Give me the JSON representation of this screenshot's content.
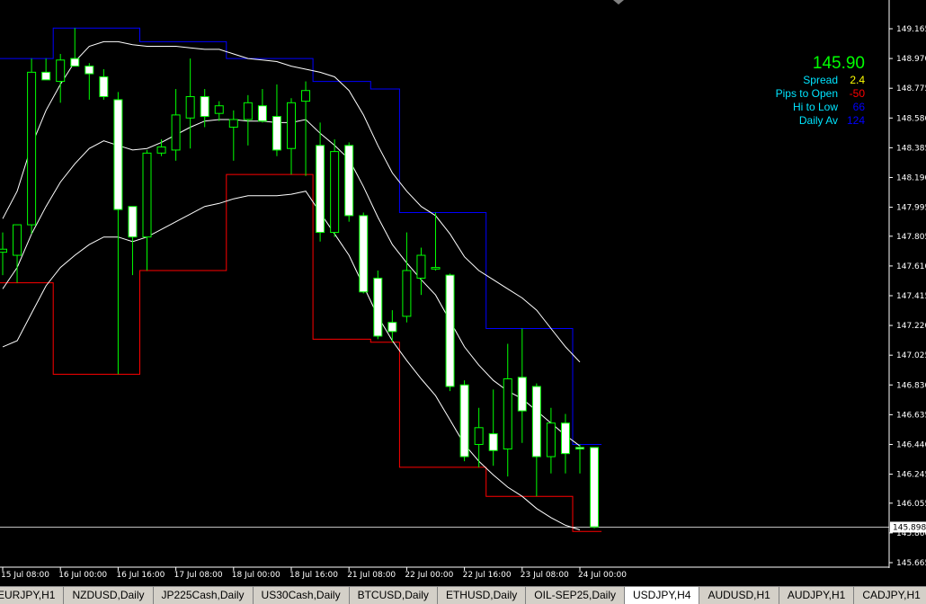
{
  "window": {
    "symbol": "USDJPY",
    "timeframe": "H4"
  },
  "info_panel": {
    "price": "145.90",
    "rows": [
      {
        "label": "Spread",
        "value": "2.4",
        "color": "#ffff00"
      },
      {
        "label": "Pips to Open",
        "value": "-50",
        "color": "#ff0000"
      },
      {
        "label": "Hi to Low",
        "value": "66",
        "color": "#0000ff"
      },
      {
        "label": "Daily Av",
        "value": "124",
        "color": "#0000ff"
      }
    ]
  },
  "colors": {
    "background": "#000000",
    "candle_outline": "#00ff00",
    "candle_bull_fill": "#000000",
    "candle_bear_fill": "#ffffff",
    "upper_channel": "#0000ff",
    "lower_channel": "#ff0000",
    "bollinger": "#ffffff",
    "axis": "#ffffff",
    "current_price_line": "#c0c0c0"
  },
  "chart_data": {
    "type": "candlestick",
    "y_axis_labels": [
      "149.165",
      "148.970",
      "148.775",
      "148.580",
      "148.385",
      "148.190",
      "147.995",
      "147.805",
      "147.610",
      "147.415",
      "147.220",
      "147.025",
      "146.830",
      "146.635",
      "146.440",
      "146.245",
      "146.055",
      "145.860",
      "145.665"
    ],
    "ylim": [
      145.665,
      149.165
    ],
    "current_price_label": "145.898",
    "current_price": 145.898,
    "x_axis_labels": [
      "15 Jul 08:00",
      "16 Jul 00:00",
      "16 Jul 16:00",
      "17 Jul 08:00",
      "18 Jul 00:00",
      "18 Jul 16:00",
      "21 Jul 08:00",
      "22 Jul 00:00",
      "22 Jul 16:00",
      "23 Jul 08:00",
      "24 Jul 00:00"
    ],
    "x_label_bars": [
      0,
      4,
      8,
      12,
      16,
      20,
      24,
      28,
      32,
      36,
      40
    ],
    "candles": [
      {
        "o": 147.7,
        "h": 147.83,
        "l": 147.55,
        "c": 147.72
      },
      {
        "o": 147.68,
        "h": 147.84,
        "l": 147.5,
        "c": 147.88
      },
      {
        "o": 147.88,
        "h": 148.97,
        "l": 147.82,
        "c": 148.88
      },
      {
        "o": 148.88,
        "h": 148.97,
        "l": 148.83,
        "c": 148.83
      },
      {
        "o": 148.82,
        "h": 149.0,
        "l": 148.68,
        "c": 148.96
      },
      {
        "o": 148.97,
        "h": 149.17,
        "l": 148.92,
        "c": 148.92
      },
      {
        "o": 148.92,
        "h": 148.94,
        "l": 148.7,
        "c": 148.87
      },
      {
        "o": 148.85,
        "h": 148.9,
        "l": 148.7,
        "c": 148.72
      },
      {
        "o": 148.7,
        "h": 148.75,
        "l": 146.9,
        "c": 147.98
      },
      {
        "o": 148.0,
        "h": 148.0,
        "l": 147.55,
        "c": 147.8
      },
      {
        "o": 147.8,
        "h": 148.37,
        "l": 147.58,
        "c": 148.35
      },
      {
        "o": 148.35,
        "h": 148.44,
        "l": 148.33,
        "c": 148.39
      },
      {
        "o": 148.37,
        "h": 148.77,
        "l": 148.3,
        "c": 148.6
      },
      {
        "o": 148.58,
        "h": 148.97,
        "l": 148.38,
        "c": 148.72
      },
      {
        "o": 148.72,
        "h": 148.77,
        "l": 148.52,
        "c": 148.59
      },
      {
        "o": 148.61,
        "h": 148.69,
        "l": 148.56,
        "c": 148.66
      },
      {
        "o": 148.52,
        "h": 148.63,
        "l": 148.3,
        "c": 148.57
      },
      {
        "o": 148.57,
        "h": 148.73,
        "l": 148.4,
        "c": 148.68
      },
      {
        "o": 148.66,
        "h": 148.77,
        "l": 148.55,
        "c": 148.56
      },
      {
        "o": 148.59,
        "h": 148.8,
        "l": 148.33,
        "c": 148.37
      },
      {
        "o": 148.38,
        "h": 148.71,
        "l": 148.21,
        "c": 148.68
      },
      {
        "o": 148.69,
        "h": 148.82,
        "l": 148.2,
        "c": 148.76
      },
      {
        "o": 148.4,
        "h": 148.55,
        "l": 147.77,
        "c": 147.83
      },
      {
        "o": 147.83,
        "h": 148.44,
        "l": 147.8,
        "c": 148.36
      },
      {
        "o": 148.4,
        "h": 148.42,
        "l": 147.9,
        "c": 147.94
      },
      {
        "o": 147.94,
        "h": 147.96,
        "l": 147.43,
        "c": 147.44
      },
      {
        "o": 147.53,
        "h": 147.58,
        "l": 147.13,
        "c": 147.15
      },
      {
        "o": 147.24,
        "h": 147.32,
        "l": 147.11,
        "c": 147.18
      },
      {
        "o": 147.28,
        "h": 147.83,
        "l": 147.24,
        "c": 147.58
      },
      {
        "o": 147.53,
        "h": 147.73,
        "l": 147.42,
        "c": 147.68
      },
      {
        "o": 147.59,
        "h": 147.96,
        "l": 147.58,
        "c": 147.6
      },
      {
        "o": 147.55,
        "h": 147.56,
        "l": 146.79,
        "c": 146.82
      },
      {
        "o": 146.83,
        "h": 146.86,
        "l": 146.33,
        "c": 146.36
      },
      {
        "o": 146.44,
        "h": 146.68,
        "l": 146.29,
        "c": 146.55
      },
      {
        "o": 146.51,
        "h": 146.8,
        "l": 146.3,
        "c": 146.4
      },
      {
        "o": 146.41,
        "h": 147.1,
        "l": 146.23,
        "c": 146.87
      },
      {
        "o": 146.88,
        "h": 147.2,
        "l": 146.45,
        "c": 146.66
      },
      {
        "o": 146.82,
        "h": 146.84,
        "l": 146.1,
        "c": 146.36
      },
      {
        "o": 146.36,
        "h": 146.68,
        "l": 146.25,
        "c": 146.58
      },
      {
        "o": 146.58,
        "h": 146.64,
        "l": 146.25,
        "c": 146.38
      },
      {
        "o": 146.42,
        "h": 146.44,
        "l": 146.25,
        "c": 146.41
      },
      {
        "o": 146.42,
        "h": 146.42,
        "l": 145.89,
        "c": 145.9
      }
    ],
    "upper_channel": [
      148.97,
      148.97,
      148.97,
      148.97,
      149.17,
      149.17,
      149.17,
      149.17,
      149.17,
      149.17,
      149.08,
      149.08,
      149.08,
      149.08,
      149.08,
      149.08,
      148.97,
      148.97,
      148.97,
      148.97,
      148.97,
      148.97,
      148.82,
      148.82,
      148.82,
      148.82,
      148.77,
      148.77,
      147.96,
      147.96,
      147.96,
      147.96,
      147.96,
      147.96,
      147.2,
      147.2,
      147.2,
      147.2,
      147.2,
      147.2,
      146.44,
      146.44
    ],
    "lower_channel": [
      147.5,
      147.5,
      147.5,
      147.5,
      146.9,
      146.9,
      146.9,
      146.9,
      146.9,
      146.9,
      147.58,
      147.58,
      147.58,
      147.58,
      147.58,
      147.58,
      148.21,
      148.21,
      148.21,
      148.21,
      148.21,
      148.21,
      147.13,
      147.13,
      147.13,
      147.13,
      147.11,
      147.11,
      146.29,
      146.29,
      146.29,
      146.29,
      146.29,
      146.29,
      146.1,
      146.1,
      146.1,
      146.1,
      146.1,
      146.1,
      145.87,
      145.87
    ],
    "bollinger_upper": [
      147.92,
      148.1,
      148.4,
      148.63,
      148.8,
      148.95,
      149.05,
      149.08,
      149.08,
      149.06,
      149.05,
      149.05,
      149.05,
      149.04,
      149.03,
      149.03,
      149.0,
      148.97,
      148.96,
      148.95,
      148.92,
      148.9,
      148.88,
      148.85,
      148.76,
      148.6,
      148.4,
      148.22,
      148.1,
      148.0,
      147.94,
      147.82,
      147.67,
      147.58,
      147.52,
      147.46,
      147.4,
      147.32,
      147.2,
      147.08,
      146.98
    ],
    "bollinger_mid": [
      147.46,
      147.6,
      147.82,
      148.0,
      148.16,
      148.28,
      148.38,
      148.43,
      148.4,
      148.37,
      148.38,
      148.42,
      148.47,
      148.52,
      148.56,
      148.57,
      148.57,
      148.56,
      148.56,
      148.55,
      148.55,
      148.57,
      148.48,
      148.4,
      148.31,
      148.13,
      147.93,
      147.75,
      147.63,
      147.52,
      147.42,
      147.25,
      147.08,
      146.96,
      146.86,
      146.79,
      146.74,
      146.66,
      146.58,
      146.5,
      146.43
    ],
    "bollinger_lower": [
      147.08,
      147.12,
      147.3,
      147.48,
      147.6,
      147.68,
      147.75,
      147.8,
      147.8,
      147.77,
      147.8,
      147.85,
      147.9,
      147.95,
      148.0,
      148.02,
      148.05,
      148.07,
      148.07,
      148.07,
      148.08,
      148.1,
      147.96,
      147.82,
      147.68,
      147.48,
      147.28,
      147.12,
      146.99,
      146.87,
      146.76,
      146.6,
      146.44,
      146.33,
      146.24,
      146.16,
      146.1,
      146.02,
      145.96,
      145.91,
      145.88
    ]
  },
  "tabs": [
    {
      "label": "EURJPY,H1"
    },
    {
      "label": "NZDUSD,Daily"
    },
    {
      "label": "JP225Cash,Daily"
    },
    {
      "label": "US30Cash,Daily"
    },
    {
      "label": "BTCUSD,Daily"
    },
    {
      "label": "ETHUSD,Daily"
    },
    {
      "label": "OIL-SEP25,Daily"
    },
    {
      "label": "USDJPY,H4",
      "active": true
    },
    {
      "label": "AUDUSD,H1"
    },
    {
      "label": "AUDJPY,H1"
    },
    {
      "label": "CADJPY,H1"
    }
  ]
}
